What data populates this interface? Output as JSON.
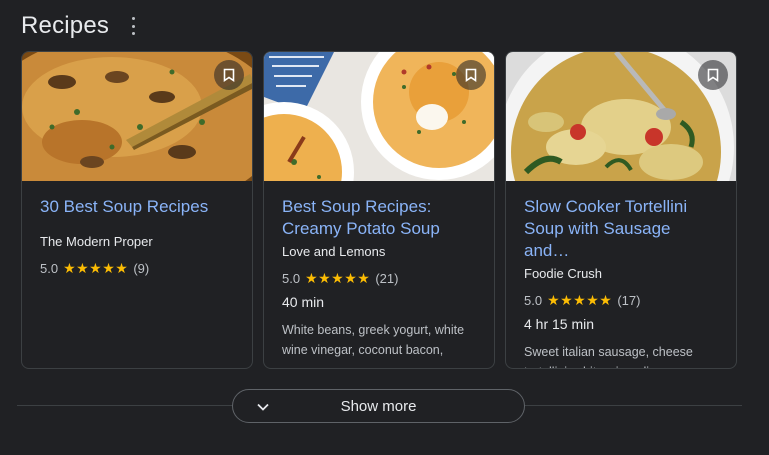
{
  "section": {
    "title": "Recipes",
    "menu_icon": "more-vert-icon"
  },
  "cards": [
    {
      "title": "30 Best Soup Recipes",
      "source": "The Modern Proper",
      "rating": "5.0",
      "stars": "★★★★★",
      "reviews": "(9)",
      "time": "",
      "ingredients": ""
    },
    {
      "title": "Best Soup Recipes: Creamy Potato Soup",
      "source": "Love and Lemons",
      "rating": "5.0",
      "stars": "★★★★★",
      "reviews": "(21)",
      "time": "40 min",
      "ingredients": "White beans, greek yogurt, white wine vinegar, coconut bacon,"
    },
    {
      "title": "Slow Cooker Tortellini Soup with Sausage and…",
      "source": "Foodie Crush",
      "rating": "5.0",
      "stars": "★★★★★",
      "reviews": "(17)",
      "time": "4 hr 15 min",
      "ingredients": "Sweet italian sausage, cheese tortellini, white wine, dinosaur"
    }
  ],
  "show_more": {
    "label": "Show more",
    "icon": "chevron-down-icon"
  },
  "colors": {
    "background": "#202124",
    "link": "#8ab4f8",
    "star": "#fbbc04",
    "border": "#3c4043"
  }
}
